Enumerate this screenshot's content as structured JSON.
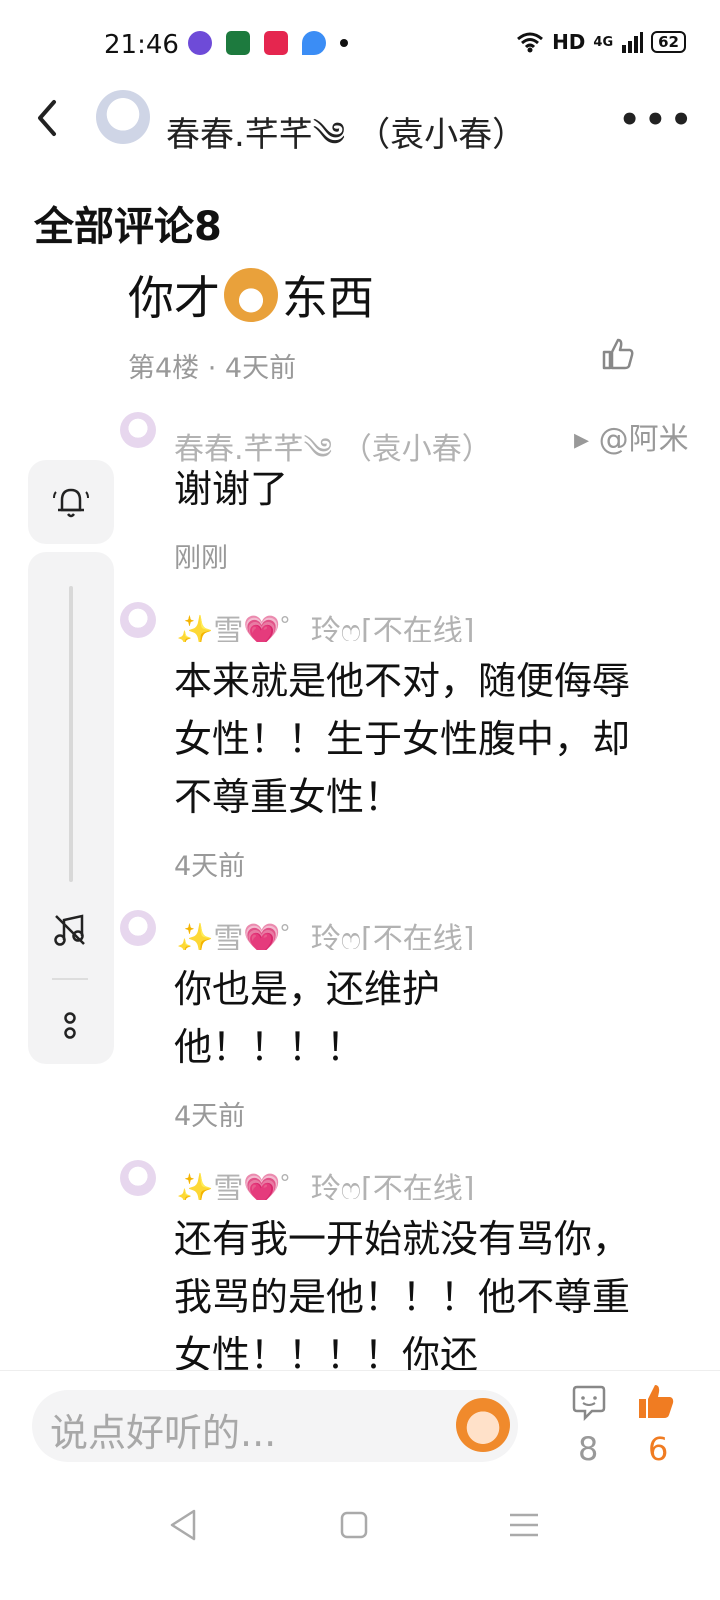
{
  "status_bar": {
    "time": "21:46",
    "network": "HD",
    "signal": "4G",
    "battery": "62"
  },
  "header": {
    "title": "春春.芊芊༄ （袁小春）"
  },
  "comments_section": {
    "title": "全部评论8"
  },
  "main_post": {
    "text_before": "你才",
    "text_after": "东西",
    "meta": "第4楼 · 4天前"
  },
  "replies": [
    {
      "name": "春春.芊芊༄ （袁小春）",
      "reply_to": "▸ @阿米",
      "text": "谢谢了",
      "time": "刚刚"
    },
    {
      "name": "✨雪💗゜玲ෆ[不在线]",
      "text": "本来就是他不对，随便侮辱女性！！生于女性腹中，却不尊重女性！",
      "time": "4天前"
    },
    {
      "name": "✨雪💗゜玲ෆ[不在线]",
      "text": "你也是，还维护他！！！！",
      "time": "4天前"
    },
    {
      "name": "✨雪💗゜玲ෆ[不在线]",
      "text": "还有我一开始就没有骂你，我骂的是他！！！他不尊重女性！！！！你还",
      "time": ""
    }
  ],
  "bottom_bar": {
    "input_placeholder": "说点好听的...",
    "comment_count": "8",
    "like_count": "6"
  },
  "colors": {
    "accent": "#f07c22",
    "secondary_text": "#999999"
  }
}
